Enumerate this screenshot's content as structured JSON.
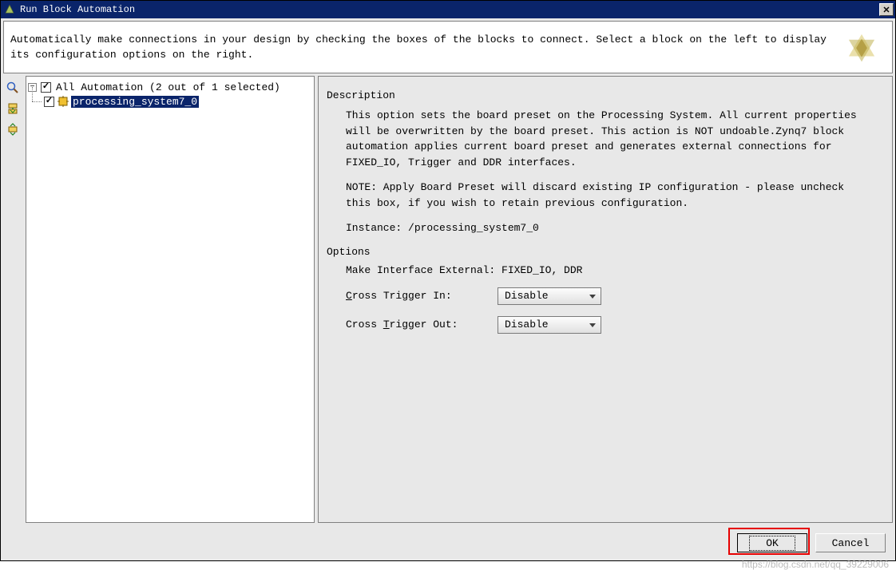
{
  "title": "Run Block Automation",
  "header_text": "Automatically make connections in your design by checking the boxes of the blocks to connect. Select a block on the left to display its configuration options on the right.",
  "tree": {
    "root_label": "All Automation (2 out of 1 selected)",
    "child_label": "processing_system7_0"
  },
  "detail": {
    "description_heading": "Description",
    "description_p1": "This option sets the board preset on the Processing System. All current properties will be overwritten by the board preset. This action is NOT undoable.Zynq7 block automation applies current board preset and generates external connections for FIXED_IO, Trigger and DDR interfaces.",
    "description_p2": "NOTE: Apply Board Preset will discard existing IP configuration - please uncheck this box, if you wish to retain previous configuration.",
    "instance_label": "Instance: /processing_system7_0",
    "options_heading": "Options",
    "make_external_label": "Make Interface External: FIXED_IO, DDR",
    "cross_trigger_in_label": "Cross Trigger In:",
    "cross_trigger_out_label": "Cross Trigger Out:",
    "cross_trigger_in_value": "Disable",
    "cross_trigger_out_value": "Disable"
  },
  "buttons": {
    "ok": "OK",
    "cancel": "Cancel"
  },
  "watermark": "https://blog.csdn.net/qq_39229006"
}
